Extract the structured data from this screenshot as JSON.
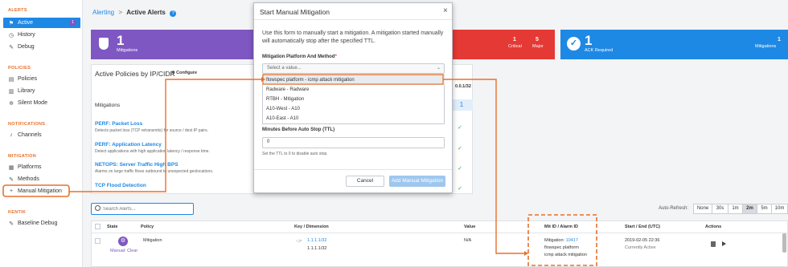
{
  "sidebar": {
    "alerts_section": "ALERTS",
    "active": "Active",
    "active_badge": "1",
    "history": "History",
    "debug": "Debug",
    "policies_section": "POLICIES",
    "policies": "Policies",
    "library": "Library",
    "silent_mode": "Silent Mode",
    "notifications_section": "NOTIFICATIONS",
    "channels": "Channels",
    "mitigation_section": "MITIGATION",
    "platforms": "Platforms",
    "methods": "Methods",
    "manual_mitigation": "Manual Mitigation",
    "kentik_section": "KENTIK",
    "baseline_debug": "Baseline Debug"
  },
  "breadcrumb": {
    "parent": "Alerting",
    "sep": ">",
    "current": "Active Alerts"
  },
  "cards": {
    "mitigations": {
      "count": "1",
      "label": "Mitigations"
    },
    "critical": {
      "count": "1",
      "label": "Critical"
    },
    "major": {
      "count": "5",
      "label": "Major"
    },
    "ack": {
      "count": "1",
      "label": "ACK Required",
      "right_count": "1",
      "right_label": "Mitigations"
    }
  },
  "colors": {
    "purple": "#7e57c2",
    "red": "#e53935",
    "blue": "#1e88e5",
    "orange": "#e8702a"
  },
  "policies_panel": {
    "title": "Active Policies by IP/CIDR",
    "configure": "Configure",
    "col_mitigations": "Mitigations",
    "ip_header": "0.0.1/32",
    "ip_value": "1",
    "rows": [
      {
        "name": "PERF: Packet Loss",
        "desc": "Detects packet loss (TCP retransmits) for source / dest IP pairs."
      },
      {
        "name": "PERF: Application Latency",
        "desc": "Detect applications with high application latency / response time."
      },
      {
        "name": "NETOPS: Server Traffic High BPS",
        "desc": "Alarms on large traffic flows outbound to unexpected geolocations."
      },
      {
        "name": "TCP Flood Detection",
        "desc": ""
      }
    ]
  },
  "modal": {
    "title": "Start Manual Mitigation",
    "close": "×",
    "intro": "Use this form to manually start a mitigation. A mitigation started manually will automatically stop after the specified TTL.",
    "platform_label": "Mitigation Platform And Method",
    "required_mark": "*",
    "select_placeholder": "Select a value...",
    "options": [
      "flowspec platform - icmp attack mitigation",
      "Radware - Radware",
      "RTBH - Mitigation",
      "A10-West - A10",
      "A10-East - A10"
    ],
    "ttl_label": "Minutes Before Auto Stop (TTL)",
    "ttl_value": "0",
    "ttl_help": "Set the TTL to 0 to disable auto stop.",
    "cancel": "Cancel",
    "submit": "Add Manual Mitigation"
  },
  "alerts": {
    "search_placeholder": "Search Alerts...",
    "auto_refresh_label": "Auto-Refresh:",
    "refresh_options": [
      "None",
      "30s",
      "1m",
      "2m",
      "5m",
      "10m"
    ],
    "refresh_selected": "2m",
    "columns": [
      "State",
      "Policy",
      "Key / Dimension",
      "Value",
      "Mit ID / Alarm ID",
      "Start / End (UTC)",
      "Actions"
    ],
    "row": {
      "state": "Manual: Clear",
      "policy": "Mitigation",
      "key1": "1.1.1.1/32",
      "key2": "1.1.1.1/32",
      "value": "N/A",
      "mit_prefix": "Mitigation:",
      "mit_id": "10417",
      "mit_platform": "flowspec platform",
      "mit_method": "icmp attack mitigation",
      "start": "2019-02-05 22:36",
      "end": "Currently Active"
    }
  }
}
